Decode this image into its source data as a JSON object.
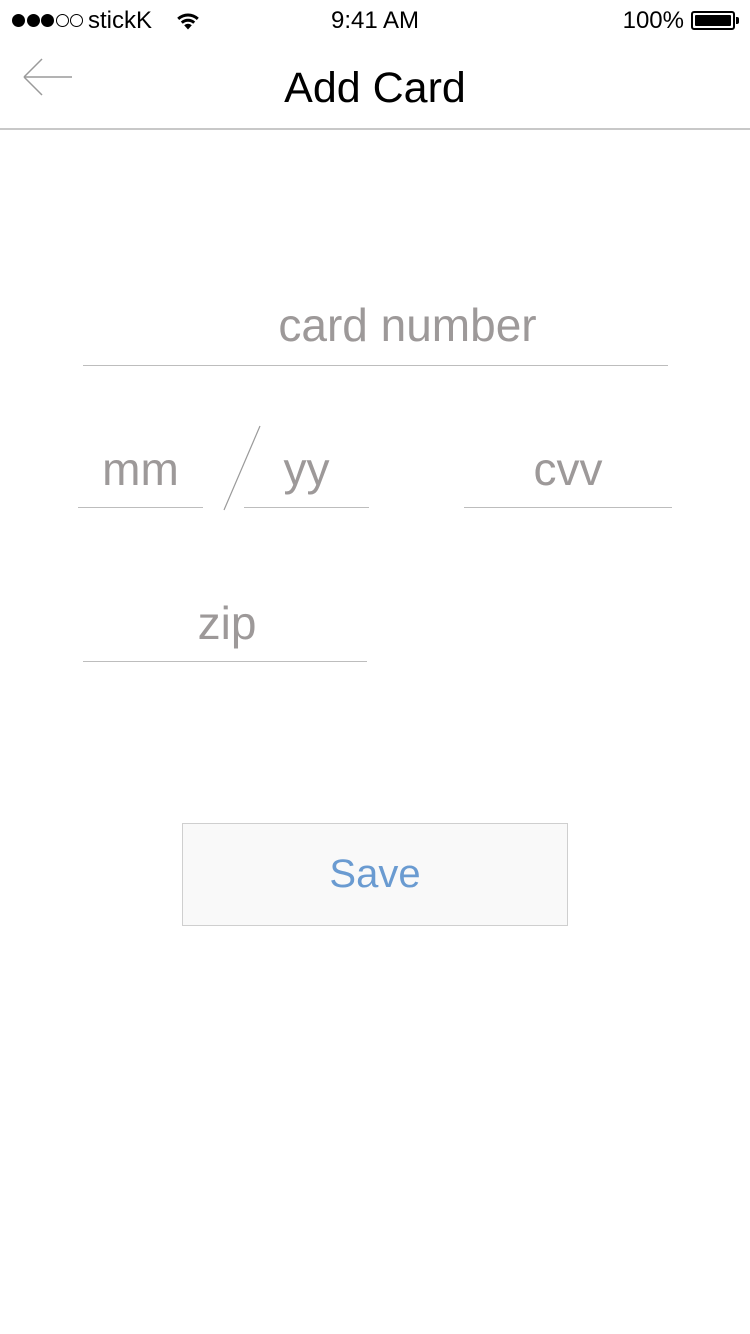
{
  "status_bar": {
    "carrier": "stickK",
    "signal_strength": 3,
    "signal_max": 5,
    "time": "9:41 AM",
    "battery_percent": "100%",
    "battery_level": 1.0
  },
  "nav": {
    "title": "Add Card",
    "back_icon": "arrow-left-icon"
  },
  "form": {
    "card_number": {
      "placeholder": "card number",
      "value": ""
    },
    "month": {
      "placeholder": "mm",
      "value": ""
    },
    "year": {
      "placeholder": "yy",
      "value": ""
    },
    "cvv": {
      "placeholder": "cvv",
      "value": ""
    },
    "zip": {
      "placeholder": "zip",
      "value": ""
    }
  },
  "save_button": {
    "label": "Save"
  },
  "colors": {
    "placeholder": "#9d9999",
    "underline": "#bdbdbd",
    "accent": "#6a9bd1",
    "button_bg": "#f9f9f9"
  }
}
